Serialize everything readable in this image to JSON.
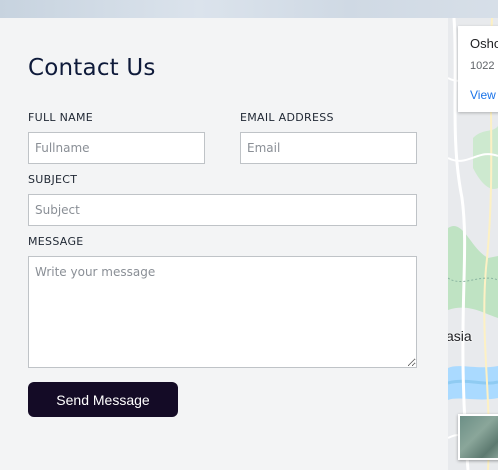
{
  "contact": {
    "title": "Contact Us",
    "full_name": {
      "label": "FULL NAME",
      "placeholder": "Fullname",
      "value": ""
    },
    "email": {
      "label": "EMAIL ADDRESS",
      "placeholder": "Email",
      "value": ""
    },
    "subject": {
      "label": "SUBJECT",
      "placeholder": "Subject",
      "value": ""
    },
    "message": {
      "label": "MESSAGE",
      "placeholder": "Write your message",
      "value": ""
    },
    "send_label": "Send Message",
    "button_color": "#140b26"
  },
  "map": {
    "place_card": {
      "title": "Osho",
      "address": "1022",
      "link": "View"
    },
    "place_label": "asia",
    "satellite_toggle_icon": "satellite-thumbnail-icon"
  }
}
